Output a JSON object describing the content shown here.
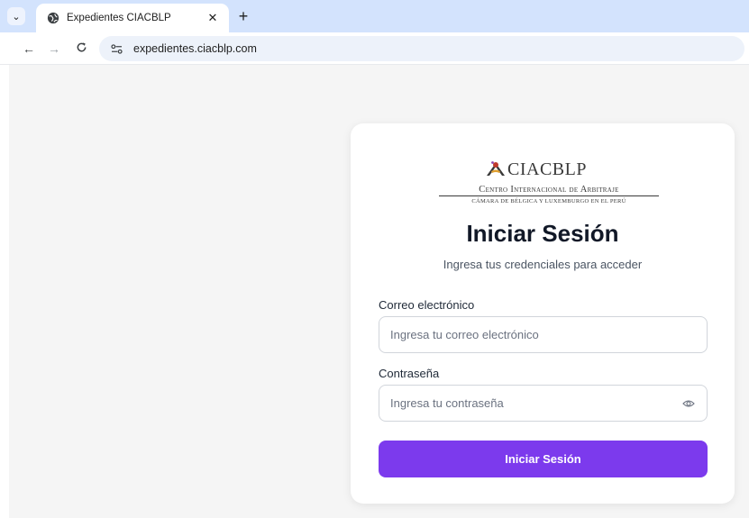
{
  "browser": {
    "tab_title": "Expedientes CIACBLP",
    "url": "expedientes.ciacblp.com",
    "icons": {
      "tab_menu": "chevron-down-icon",
      "favicon": "globe-icon",
      "close": "close-icon",
      "new_tab": "plus-icon",
      "back": "arrow-left-icon",
      "forward": "arrow-right-icon",
      "reload": "reload-icon",
      "site_info": "tune-icon"
    }
  },
  "logo": {
    "name": "CIACBLP",
    "line1": "Centro Internacional de Arbitraje",
    "line2": "Cámara de Bélgica y Luxemburgo en el Perú"
  },
  "login": {
    "title": "Iniciar Sesión",
    "subtitle": "Ingresa tus credenciales para acceder",
    "email_label": "Correo electrónico",
    "email_placeholder": "Ingresa tu correo electrónico",
    "email_value": "",
    "password_label": "Contraseña",
    "password_placeholder": "Ingresa tu contraseña",
    "password_value": "",
    "submit_label": "Iniciar Sesión",
    "show_password_icon": "eye-icon"
  },
  "colors": {
    "accent": "#7c3aed",
    "tabbar": "#d3e3fd",
    "page_background": "#f5f5f5"
  }
}
